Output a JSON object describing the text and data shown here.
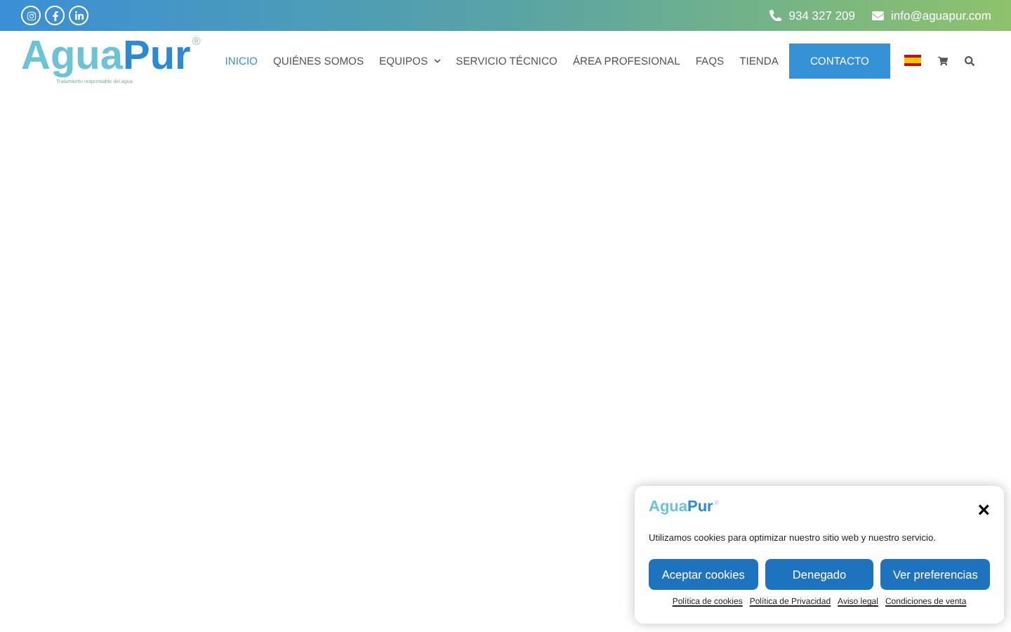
{
  "top_bar": {
    "social": [
      {
        "kind": "instagram"
      },
      {
        "kind": "facebook"
      },
      {
        "kind": "linkedin"
      }
    ],
    "phone": "934 327 209",
    "email": "info@aguapur.com"
  },
  "header": {
    "logo": {
      "part_1": "Agua",
      "part_2": "Pur",
      "mark": "®",
      "tagline": "Tratamiento responsable del agua"
    },
    "nav": [
      {
        "label": "INICIO",
        "selected": true,
        "kind": "link"
      },
      {
        "label": "QUIÉNES SOMOS",
        "selected": false,
        "kind": "link"
      },
      {
        "label": "EQUIPOS",
        "selected": false,
        "kind": "link",
        "has_menu": true
      },
      {
        "label": "SERVICIO TÉCNICO",
        "selected": false,
        "kind": "link"
      },
      {
        "label": "ÁREA PROFESIONAL",
        "selected": false,
        "kind": "link"
      },
      {
        "label": "FAQS",
        "selected": false,
        "kind": "link"
      },
      {
        "label": "TIENDA",
        "selected": false,
        "kind": "link"
      },
      {
        "label": "CONTACTO",
        "selected": false,
        "kind": "button"
      }
    ]
  },
  "cookie_banner": {
    "logo": {
      "part_1": "Agua",
      "part_2": "Pur",
      "mark": "®"
    },
    "close": "×",
    "message": "Utilizamos cookies para optimizar nuestro sitio web y nuestro servicio.",
    "buttons": [
      "Aceptar cookies",
      "Denegado",
      "Ver preferencias"
    ],
    "links": [
      "Política de cookies",
      "Política de Privacidad",
      "Aviso legal",
      "Condiciones de venta"
    ]
  }
}
